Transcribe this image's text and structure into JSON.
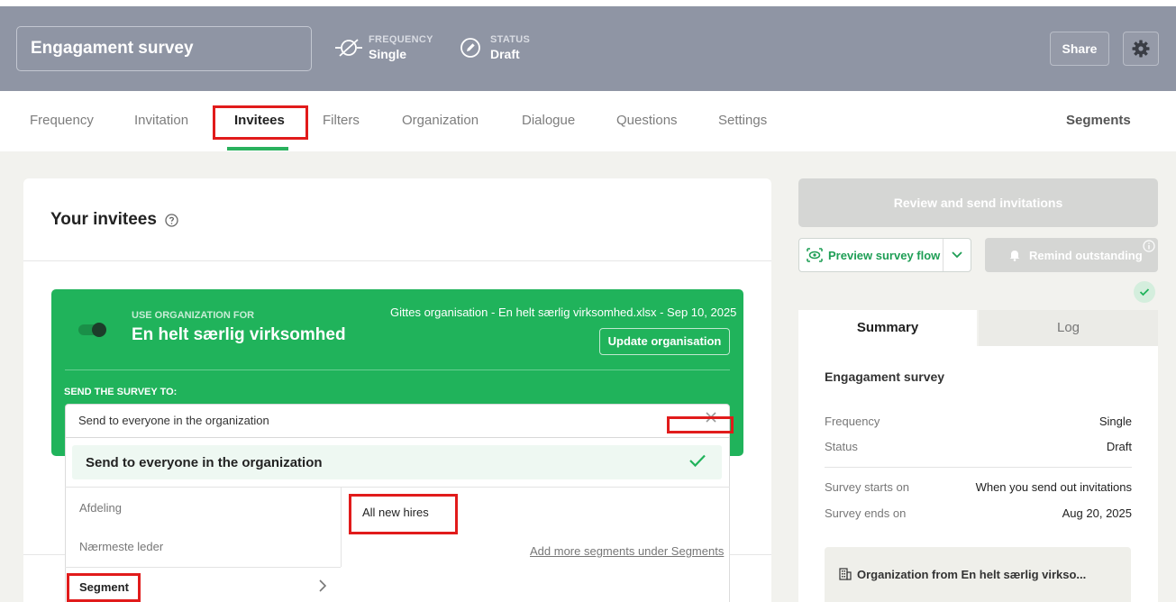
{
  "header": {
    "survey_title": "Engagament survey",
    "frequency_label": "FREQUENCY",
    "frequency_value": "Single",
    "status_label": "STATUS",
    "status_value": "Draft",
    "share_label": "Share"
  },
  "tabs": [
    {
      "label": "Frequency"
    },
    {
      "label": "Invitation"
    },
    {
      "label": "Invitees"
    },
    {
      "label": "Filters"
    },
    {
      "label": "Organization"
    },
    {
      "label": "Dialogue"
    },
    {
      "label": "Questions"
    },
    {
      "label": "Settings"
    }
  ],
  "tabs_right": "Segments",
  "main": {
    "title": "Your invitees",
    "org_card": {
      "use_label": "USE ORGANIZATION FOR",
      "org_name": "En helt særlig virksomhed",
      "file_info": "Gittes organisation - En helt særlig virksomhed.xlsx - Sep 10, 2025",
      "update_label": "Update organisation",
      "send_to_label": "SEND THE SURVEY TO:"
    },
    "select": {
      "value": "Send to everyone in the organization"
    },
    "dropdown": {
      "selected": "Send to everyone in the organization",
      "groups": [
        "Afdeling",
        "Nærmeste leder",
        "Segment"
      ],
      "sub_items": [
        "All new hires"
      ],
      "add_more_link": "Add more segments under Segments"
    }
  },
  "sidebar": {
    "review_label": "Review and send invitations",
    "preview_label": "Preview survey flow",
    "remind_label": "Remind outstanding",
    "summary_tab": "Summary",
    "log_tab": "Log",
    "summary": {
      "title": "Engagament survey",
      "rows": [
        {
          "label": "Frequency",
          "value": "Single"
        },
        {
          "label": "Status",
          "value": "Draft"
        },
        {
          "label": "Survey starts on",
          "value": "When you send out invitations"
        },
        {
          "label": "Survey ends on",
          "value": "Aug 20, 2025"
        }
      ],
      "org_text": "Organization from En helt særlig virkso..."
    }
  },
  "colors": {
    "accent_green": "#20b35b",
    "header_bg": "#8f95a4",
    "highlight_red": "#e11b1b"
  }
}
